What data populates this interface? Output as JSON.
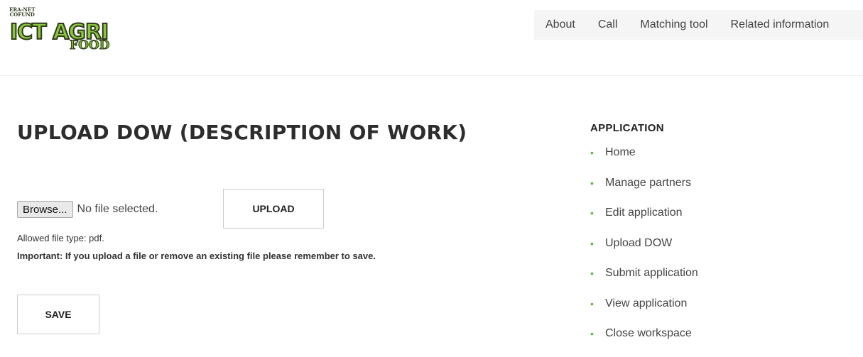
{
  "logo": {
    "top_line1": "ERA-NET",
    "top_line2": "COFUND",
    "main_text": "ICT AGRI",
    "sub_text": "FOOD"
  },
  "nav": {
    "items": [
      {
        "label": "About"
      },
      {
        "label": "Call"
      },
      {
        "label": "Matching tool"
      },
      {
        "label": "Related information"
      }
    ]
  },
  "main": {
    "title": "UPLOAD DOW (DESCRIPTION OF WORK)",
    "file_input": {
      "browse_label": "Browse...",
      "status_text": "No file selected."
    },
    "upload_label": "UPLOAD",
    "allowed_text": "Allowed file type: pdf.",
    "important_text": "Important: If you upload a file or remove an existing file please remember to save.",
    "save_label": "SAVE"
  },
  "sidebar": {
    "title": "APPLICATION",
    "items": [
      {
        "label": "Home"
      },
      {
        "label": "Manage partners"
      },
      {
        "label": "Edit application"
      },
      {
        "label": "Upload DOW"
      },
      {
        "label": "Submit application"
      },
      {
        "label": "View application"
      },
      {
        "label": "Close workspace"
      }
    ]
  },
  "colors": {
    "brand_green": "#8cc63f",
    "bullet_green": "#6ab04c",
    "nav_background": "#f5f5f5"
  }
}
